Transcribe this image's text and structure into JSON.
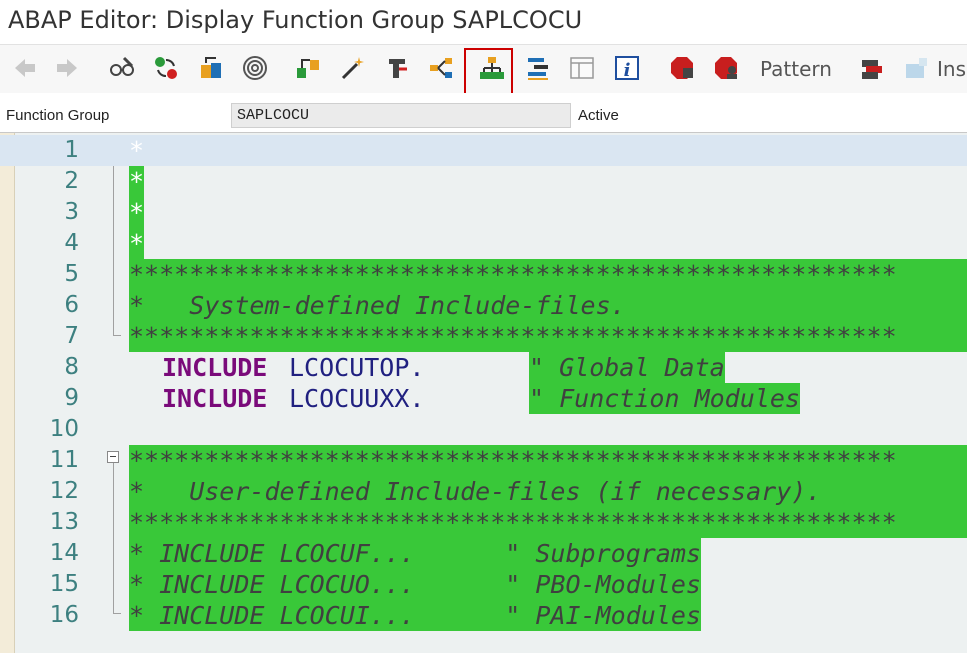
{
  "window": {
    "title": "ABAP Editor: Display Function Group SAPLCOCU"
  },
  "toolbar": {
    "back_icon": "arrow-left-icon",
    "forward_icon": "arrow-right-icon",
    "pattern_label": "Pattern",
    "insert_label": "Ins",
    "highlighted_button": "object-hierarchy-icon",
    "highlight_color": "#cc0000"
  },
  "header": {
    "function_group_label": "Function Group",
    "function_group_value": "SAPLCOCU",
    "status": "Active"
  },
  "editor": {
    "comment_bg": "#39c839",
    "lines": [
      {
        "n": "1",
        "text": "*"
      },
      {
        "n": "2",
        "text": "*"
      },
      {
        "n": "3",
        "text": "*"
      },
      {
        "n": "4",
        "text": "*"
      },
      {
        "n": "5",
        "text": "***************************************************"
      },
      {
        "n": "6",
        "text": "*   System-defined Include-files."
      },
      {
        "n": "7",
        "text": "***************************************************"
      },
      {
        "n": "8",
        "keyword": "INCLUDE",
        "name": "LCOCUTOP.",
        "comment": "\" Global Data"
      },
      {
        "n": "9",
        "keyword": "INCLUDE",
        "name": "LCOCUUXX.",
        "comment": "\" Function Modules"
      },
      {
        "n": "10",
        "text": ""
      },
      {
        "n": "11",
        "text": "***************************************************"
      },
      {
        "n": "12",
        "text": "*   User-defined Include-files (if necessary)."
      },
      {
        "n": "13",
        "text": "***************************************************"
      },
      {
        "n": "14",
        "text": "* INCLUDE LCOCUF...      \" Subprograms"
      },
      {
        "n": "15",
        "text": "* INCLUDE LCOCUO...      \" PBO-Modules"
      },
      {
        "n": "16",
        "text": "* INCLUDE LCOCUI...      \" PAI-Modules"
      }
    ]
  }
}
